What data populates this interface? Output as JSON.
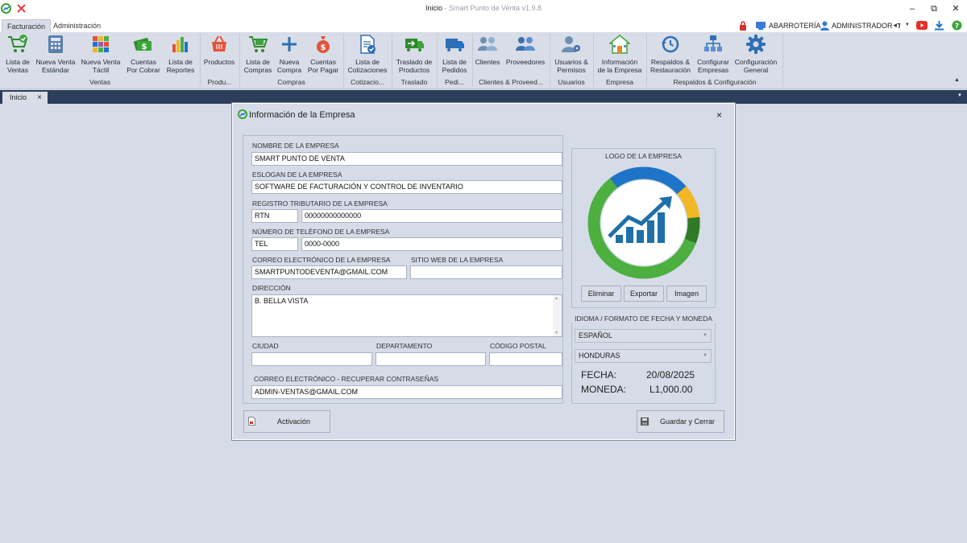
{
  "window": {
    "title_main": "Inicio",
    "title_sep": " - ",
    "title_app": "Smart Punto de Venta v1.9.8"
  },
  "ribbon_tabs": [
    "Facturación",
    "Administración"
  ],
  "status": {
    "store": "ABARROTERÍA",
    "user": "ADMINISTRADOR"
  },
  "ribbon": {
    "buttons": [
      {
        "name": "lista-de-ventas",
        "icon": "cart-check-icon",
        "label1": "Lista de",
        "label2": "Ventas"
      },
      {
        "name": "nueva-venta-estandar",
        "icon": "calculator-icon",
        "label1": "Nueva Venta",
        "label2": "Estándar"
      },
      {
        "name": "nueva-venta-tactil",
        "icon": "grid-icon",
        "label1": "Nueva Venta",
        "label2": "Táctil"
      },
      {
        "name": "cuentas-por-cobrar",
        "icon": "money-icon",
        "label1": "Cuentas",
        "label2": "Por Cobrar"
      },
      {
        "name": "lista-de-reportes",
        "icon": "bar-chart-icon",
        "label1": "Lista de",
        "label2": "Reportes"
      },
      {
        "name": "productos",
        "icon": "basket-icon",
        "label1": "Productos",
        "label2": ""
      },
      {
        "name": "lista-de-compras",
        "icon": "cart-icon",
        "label1": "Lista de",
        "label2": "Compras"
      },
      {
        "name": "nueva-compra",
        "icon": "plus-icon",
        "label1": "Nueva",
        "label2": "Compra"
      },
      {
        "name": "cuentas-por-pagar",
        "icon": "money-bag-icon",
        "label1": "Cuentas",
        "label2": "Por Pagar"
      },
      {
        "name": "lista-de-cotizaciones",
        "icon": "document-check-icon",
        "label1": "Lista de",
        "label2": "Cotizaciones"
      },
      {
        "name": "traslado-de-productos",
        "icon": "transfer-icon",
        "label1": "Traslado de",
        "label2": "Productos"
      },
      {
        "name": "lista-de-pedidos",
        "icon": "truck-icon",
        "label1": "Lista de",
        "label2": "Pedidos"
      },
      {
        "name": "clientes",
        "icon": "users-icon",
        "label1": "Clientes",
        "label2": ""
      },
      {
        "name": "proveedores",
        "icon": "users-icon",
        "label1": "Proveedores",
        "label2": ""
      },
      {
        "name": "usuarios-y-permisos",
        "icon": "user-gear-icon",
        "label1": "Usuarios &",
        "label2": "Permisos"
      },
      {
        "name": "informacion-de-la-empresa",
        "icon": "house-icon",
        "label1": "Información",
        "label2": "de la Empresa"
      },
      {
        "name": "respaldos-y-restauracion",
        "icon": "backup-icon",
        "label1": "Respaldos &",
        "label2": "Restauración"
      },
      {
        "name": "configurar-empresas",
        "icon": "org-chart-icon",
        "label1": "Configurar",
        "label2": "Empresas"
      },
      {
        "name": "configuracion-general",
        "icon": "gear-icon",
        "label1": "Configuración",
        "label2": "General"
      }
    ],
    "groups": [
      "Ventas",
      "Produ...",
      "Compras",
      "Cotizacio...",
      "Traslado",
      "Pedi...",
      "Clientes & Proveed...",
      "Usuarios",
      "Empresa",
      "Respaldos & Configuración"
    ]
  },
  "doc_tab": "Inicio",
  "dialog": {
    "title": "Información de la Empresa",
    "labels": {
      "company_name": "NOMBRE DE LA EMPRESA",
      "slogan": "ESLOGAN DE LA EMPRESA",
      "tax_id": "REGISTRO TRIBUTARIO DE LA EMPRESA",
      "phone": "NÚMERO DE TELÉFONO DE LA EMPRESA",
      "email": "CORREO ELECTRÓNICO DE LA EMPRESA",
      "website": "SITIO WEB DE LA EMPRESA",
      "address": "DIRECCIÓN",
      "city": "CIUDAD",
      "department": "DEPARTAMENTO",
      "postal": "CÓDIGO POSTAL",
      "recovery_email": "CORREO ELECTRÓNICO - RECUPERAR CONTRASEÑAS",
      "logo": "LOGO DE LA EMPRESA",
      "locale": "IDIOMA / FORMATO DE FECHA Y MONEDA",
      "date": "FECHA:",
      "currency": "MONEDA:"
    },
    "values": {
      "company_name": "SMART PUNTO DE VENTA",
      "slogan": "SOFTWARE DE FACTURACIÓN Y CONTROL DE INVENTARIO",
      "tax_prefix": "RTN",
      "tax_id": "00000000000000",
      "phone_prefix": "TEL",
      "phone": "0000-0000",
      "email": "SMARTPUNTODEVENTA@GMAIL.COM",
      "website": "",
      "address": "B. BELLA VISTA",
      "city": "",
      "department": "",
      "postal": "",
      "recovery_email": "ADMIN-VENTAS@GMAIL.COM",
      "language": "ESPAÑOL",
      "country": "HONDURAS",
      "date": "20/08/2025",
      "currency": "L1,000.00"
    },
    "buttons": {
      "delete": "Eliminar",
      "export": "Exportar",
      "image": "Imagen",
      "activation": "Activación",
      "save_close": "Guardar y Cerrar"
    }
  },
  "colors": {
    "accent_blue": "#2f6fb3",
    "ribbon_bg": "#d9dde7",
    "doctab_bar": "#2c3e5c",
    "logo_green": "#4caf3f",
    "logo_blue": "#1e74c8",
    "logo_yellow": "#f2b724",
    "logo_dark_green": "#2e7a26"
  }
}
